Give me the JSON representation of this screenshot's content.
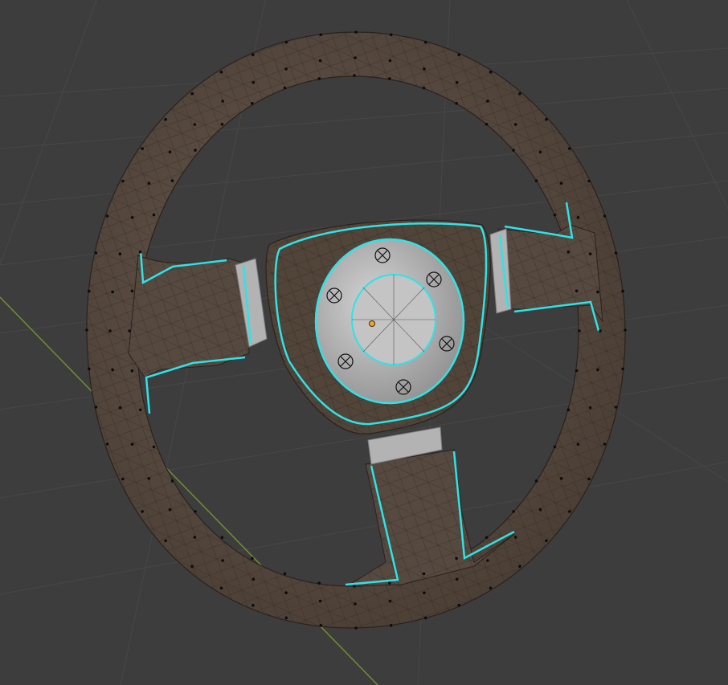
{
  "viewport": {
    "background": "#3d3d3d",
    "grid_color": "#4a4a4a",
    "y_axis_color": "#7a9a3a"
  },
  "model": {
    "rim_color": "#5a4c42",
    "rim_shade": "#43382f",
    "edge_color": "#2a221d",
    "vertex_color": "#0d0d0d",
    "seam_color": "#2ee3e8",
    "hub_color": "#b9b9b9",
    "hub_shade": "#8c8c8c",
    "origin_color": "#f5a623"
  }
}
